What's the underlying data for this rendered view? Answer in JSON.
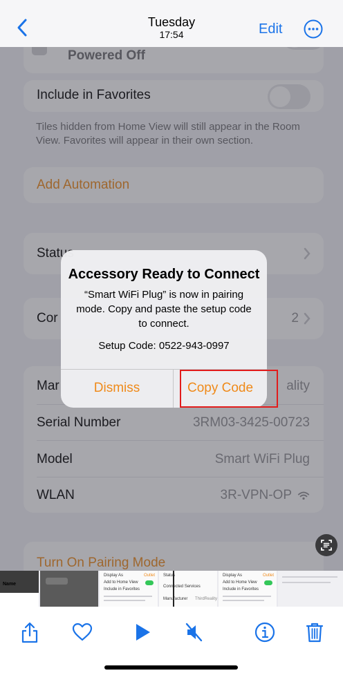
{
  "nav": {
    "day": "Tuesday",
    "time": "17:54",
    "edit_label": "Edit"
  },
  "settings": {
    "powered_off_label": "Powered Off",
    "include_favorites_label": "Include in Favorites",
    "footnote": "Tiles hidden from Home View will still appear in the Room View. Favorites will appear in their own section.",
    "add_automation_label": "Add Automation",
    "status_label": "Status",
    "connected_label": "Cor",
    "connected_value": "2",
    "manufacturer_label": "Mar",
    "manufacturer_value": "ality",
    "serial_label": "Serial Number",
    "serial_value": "3RM03-3425-00723",
    "model_label": "Model",
    "model_value": "Smart WiFi Plug",
    "wlan_label": "WLAN",
    "wlan_value": "3R-VPN-OP",
    "pairing_label": "Turn On Pairing Mode"
  },
  "alert": {
    "title": "Accessory Ready to Connect",
    "message": "“Smart WiFi Plug” is now in pairing mode. Copy and paste the setup code to connect.",
    "setup_code": "Setup Code: 0522-943-0997",
    "dismiss_label": "Dismiss",
    "copy_label": "Copy Code"
  },
  "filmstrip": {
    "name_label": "Name",
    "thumb1_label": "Display As",
    "thumb1_action": "Outlet",
    "thumb1_row2": "Add to Home View",
    "thumb1_row3": "Include in Favorites",
    "thumb2_label": "Status",
    "thumb2_row2": "Connected Services",
    "thumb2_row3": "Manufacturer",
    "thumb2_row3_value": "ThirdReality",
    "thumb3_label": "Display As",
    "thumb3_action": "Outlet",
    "thumb3_row2": "Add to Home View",
    "thumb3_row3": "Include in Favorites"
  },
  "colors": {
    "accent": "#ef8a1a",
    "link": "#1a73e8",
    "highlight_box": "#e21b1b"
  },
  "icons": [
    "back-chevron-icon",
    "more-ellipsis-icon",
    "share-icon",
    "heart-icon",
    "play-icon",
    "mute-icon",
    "info-icon",
    "trash-icon",
    "live-text-icon",
    "wifi-icon"
  ]
}
